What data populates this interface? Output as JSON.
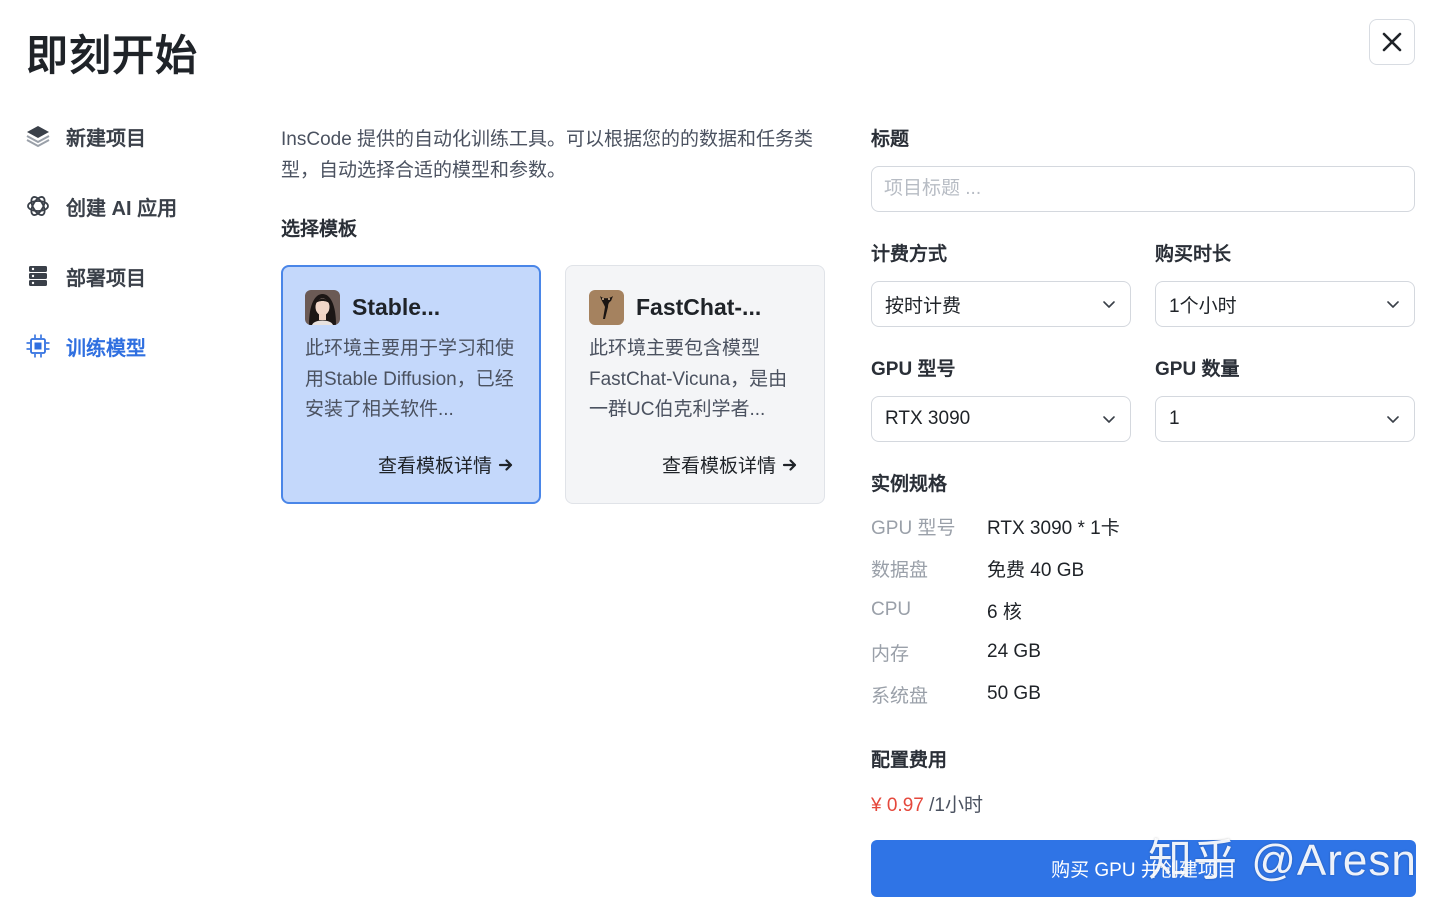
{
  "header": {
    "title": "即刻开始"
  },
  "sidebar": {
    "items": [
      {
        "label": "新建项目",
        "icon": "layers-icon",
        "active": false
      },
      {
        "label": "创建 AI 应用",
        "icon": "openai-icon",
        "active": false
      },
      {
        "label": "部署项目",
        "icon": "server-icon",
        "active": false
      },
      {
        "label": "训练模型",
        "icon": "chip-icon",
        "active": true
      }
    ]
  },
  "main": {
    "intro": "InsCode 提供的自动化训练工具。可以根据您的的数据和任务类型，自动选择合适的模型和参数。",
    "template_section_title": "选择模板",
    "templates": [
      {
        "title": "Stable...",
        "description": "此环境主要用于学习和使用Stable Diffusion，已经安装了相关软件...",
        "link": "查看模板详情",
        "selected": true
      },
      {
        "title": "FastChat-...",
        "description": "此环境主要包含模型FastChat-Vicuna，是由一群UC伯克利学者...",
        "link": "查看模板详情",
        "selected": false
      }
    ]
  },
  "form": {
    "title_label": "标题",
    "title_placeholder": "项目标题 ...",
    "billing_label": "计费方式",
    "billing_value": "按时计费",
    "duration_label": "购买时长",
    "duration_value": "1个小时",
    "gpu_model_label": "GPU 型号",
    "gpu_model_value": "RTX 3090",
    "gpu_count_label": "GPU 数量",
    "gpu_count_value": "1",
    "spec_title": "实例规格",
    "specs": [
      {
        "key": "GPU 型号",
        "value": "RTX 3090 * 1卡"
      },
      {
        "key": "数据盘",
        "value": "免费 40 GB"
      },
      {
        "key": "CPU",
        "value": "6 核"
      },
      {
        "key": "内存",
        "value": "24 GB"
      },
      {
        "key": "系统盘",
        "value": "50 GB"
      }
    ],
    "fee_title": "配置费用",
    "fee_amount": "¥ 0.97",
    "fee_unit": " /1小时",
    "buy_button": "购买 GPU 并创建项目"
  },
  "watermark": "知乎 @Aresn",
  "colors": {
    "accent": "#2f74e6",
    "selected_card": "#c4d8fb",
    "price": "#e5483c"
  }
}
